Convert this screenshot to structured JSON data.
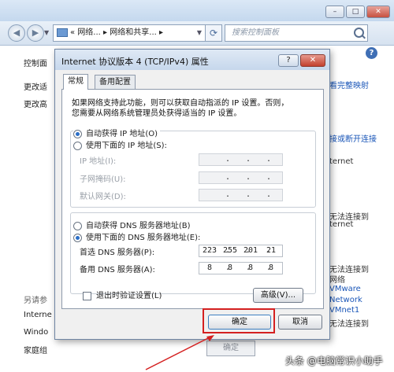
{
  "breadcrumb": {
    "chevrons": "«",
    "seg1": "网络...",
    "sep": "▸",
    "seg2": "网络和共享...",
    "seg2_arrow": "▸"
  },
  "search": {
    "placeholder": "搜索控制面板"
  },
  "window_controls": {
    "min": "–",
    "max": "□",
    "close": "✕"
  },
  "left_panel": {
    "items": [
      "控制面",
      "更改适",
      "更改高"
    ],
    "see_also": "另请参",
    "see_also_items": [
      "Interne",
      "Windo",
      "家庭组"
    ]
  },
  "right_panel": {
    "items": [
      {
        "text": "看完整映射",
        "link": true
      },
      {
        "text": "接或断开连接",
        "link": true
      },
      {
        "text": "ternet",
        "link": false
      },
      {
        "text": "无法连接到",
        "link": false
      },
      {
        "text": "ternet",
        "link": false
      },
      {
        "text": "无法连接到",
        "link": false
      },
      {
        "text": "网络",
        "link": false
      },
      {
        "text": "VMware",
        "link": true
      },
      {
        "text": "Network",
        "link": true
      },
      {
        "text": "VMnet1",
        "link": true
      },
      {
        "text": "无法连接到",
        "link": false
      }
    ]
  },
  "dialog": {
    "title": "Internet 协议版本 4 (TCP/IPv4) 属性",
    "help_label": "?",
    "close_label": "✕",
    "tabs": [
      "常规",
      "备用配置"
    ],
    "description_line1": "如果网络支持此功能，则可以获取自动指派的 IP 设置。否则，",
    "description_line2": "您需要从网络系统管理员处获得适当的 IP 设置。",
    "ip_auto_label": "自动获得 IP 地址(O)",
    "ip_manual_label": "使用下面的 IP 地址(S):",
    "ip_mode": "auto",
    "ip_fields": [
      {
        "label": "IP 地址(I):"
      },
      {
        "label": "子网掩码(U):"
      },
      {
        "label": "默认网关(D):"
      }
    ],
    "dns_auto_label": "自动获得 DNS 服务器地址(B)",
    "dns_manual_label": "使用下面的 DNS 服务器地址(E):",
    "dns_mode": "manual",
    "dns_fields": [
      {
        "label": "首选 DNS 服务器(P):",
        "octets": [
          "223",
          "255",
          "201",
          "21"
        ]
      },
      {
        "label": "备用 DNS 服务器(A):",
        "octets": [
          "8",
          "8",
          "8",
          "8"
        ]
      }
    ],
    "validate_label": "退出时验证设置(L)",
    "validate_checked": false,
    "advanced_label": "高级(V)...",
    "ok_label": "确定",
    "cancel_label": "取消"
  },
  "background_ok_label": "确定",
  "annotation_color": "#d42020",
  "watermark": "头条 @电脑常识小助手"
}
